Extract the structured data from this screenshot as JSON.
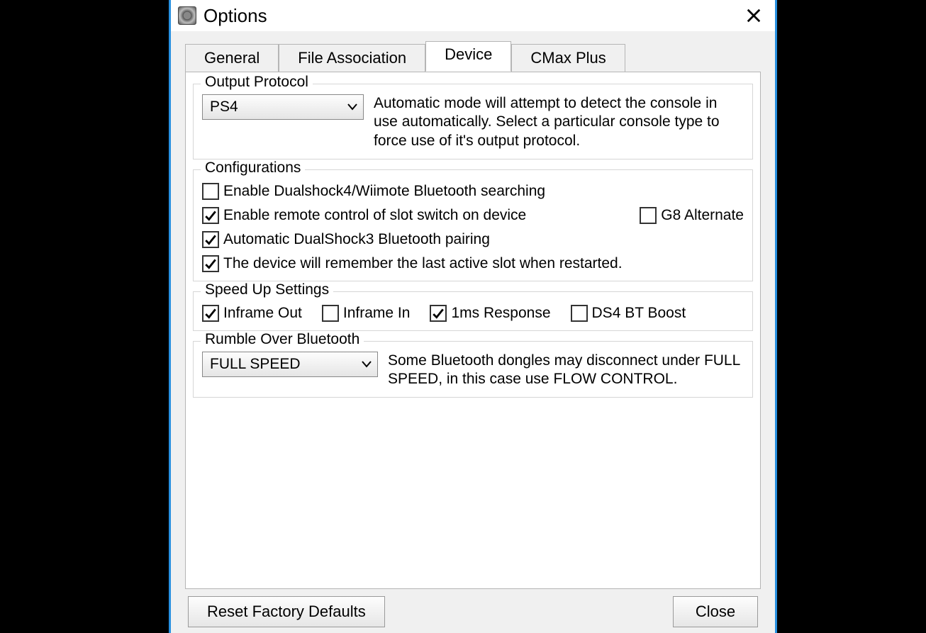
{
  "window": {
    "title": "Options"
  },
  "tabs": {
    "general": "General",
    "file_association": "File Association",
    "device": "Device",
    "cmax_plus": "CMax Plus"
  },
  "output_protocol": {
    "legend": "Output Protocol",
    "selected": "PS4",
    "description": "Automatic mode will attempt to detect the console in use automatically. Select a particular console type to force use of it's output protocol."
  },
  "configurations": {
    "legend": "Configurations",
    "items": {
      "ds4_wiimote_bt": {
        "label": "Enable Dualshock4/Wiimote Bluetooth searching",
        "checked": false
      },
      "remote_slot": {
        "label": "Enable remote control of slot switch on device",
        "checked": true
      },
      "g8_alternate": {
        "label": "G8 Alternate",
        "checked": false
      },
      "ds3_bt_pairing": {
        "label": "Automatic DualShock3 Bluetooth pairing",
        "checked": true
      },
      "remember_slot": {
        "label": "The device will remember the last active slot when restarted.",
        "checked": true
      }
    }
  },
  "speed_up": {
    "legend": "Speed Up Settings",
    "items": {
      "inframe_out": {
        "label": "Inframe Out",
        "checked": true
      },
      "inframe_in": {
        "label": "Inframe In",
        "checked": false
      },
      "one_ms": {
        "label": "1ms Response",
        "checked": true
      },
      "ds4_bt_boost": {
        "label": "DS4 BT Boost",
        "checked": false
      }
    }
  },
  "rumble": {
    "legend": "Rumble Over Bluetooth",
    "selected": "FULL SPEED",
    "description": "Some Bluetooth dongles may disconnect under FULL SPEED, in this case use FLOW CONTROL."
  },
  "footer": {
    "reset": "Reset Factory Defaults",
    "close": "Close"
  }
}
